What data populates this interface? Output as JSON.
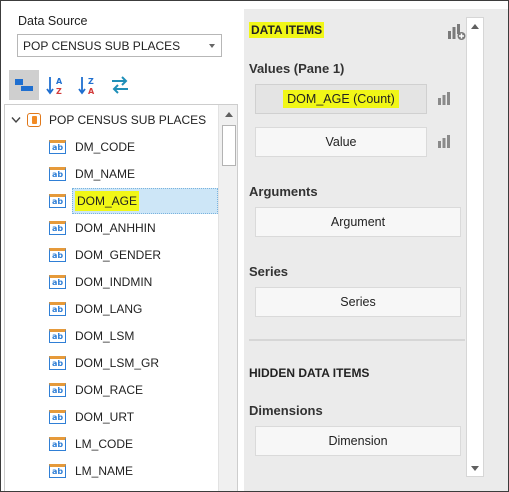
{
  "data_source": {
    "label": "Data Source",
    "selected": "POP CENSUS SUB PLACES"
  },
  "toolbar": {
    "buttons": [
      {
        "icon": "group-fields-icon",
        "active": true
      },
      {
        "icon": "sort-ascending-icon",
        "active": false
      },
      {
        "icon": "sort-descending-icon",
        "active": false
      },
      {
        "icon": "refresh-swap-icon",
        "active": false
      }
    ]
  },
  "tree": {
    "root": "POP CENSUS SUB PLACES",
    "field_icon": "ab",
    "items": [
      "DM_CODE",
      "DM_NAME",
      "DOM_AGE",
      "DOM_ANHHIN",
      "DOM_GENDER",
      "DOM_INDMIN",
      "DOM_LANG",
      "DOM_LSM",
      "DOM_LSM_GR",
      "DOM_RACE",
      "DOM_URT",
      "LM_CODE",
      "LM_NAME",
      ""
    ],
    "selected_index": 2
  },
  "data_items": {
    "title": "DATA ITEMS",
    "values_label": "Values (Pane 1)",
    "value_slots": [
      "DOM_AGE (Count)",
      "Value"
    ],
    "arguments_label": "Arguments",
    "argument_slot": "Argument",
    "series_label": "Series",
    "series_slot": "Series"
  },
  "hidden_data_items": {
    "title": "HIDDEN DATA ITEMS",
    "dimensions_label": "Dimensions",
    "dimension_slot": "Dimension"
  },
  "colors": {
    "highlight": "#f1f717",
    "selection": "#cde6f7",
    "accent_blue": "#2f7fd6",
    "accent_orange": "#e69a3a"
  }
}
